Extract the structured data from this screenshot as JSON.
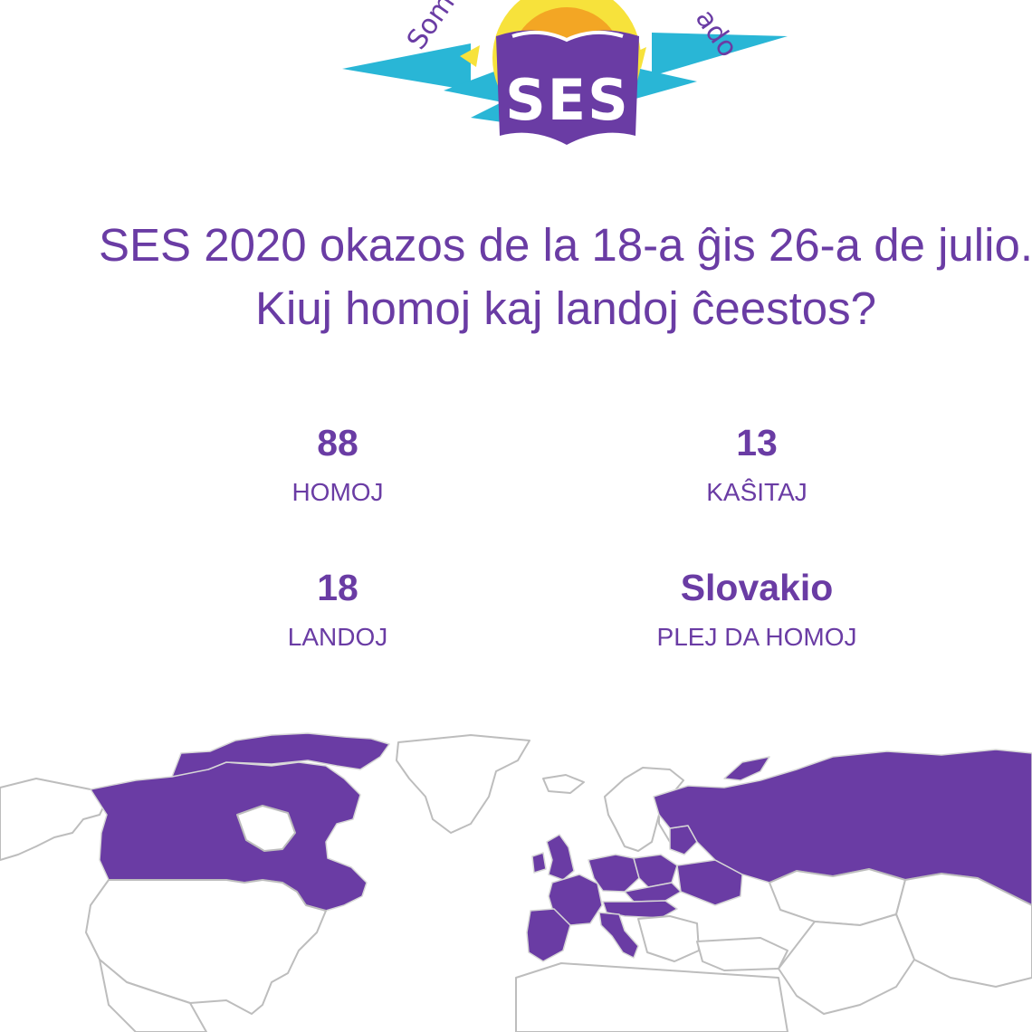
{
  "logo": {
    "abbreviation": "SES",
    "arc_left": "Som",
    "arc_right": "ado",
    "colors": {
      "purple": "#6a3ca4",
      "cyan": "#29b6d6",
      "yellow": "#f7e23b",
      "orange": "#f3a624"
    }
  },
  "headline": {
    "line1": "SES 2020 okazos de la 18-a ĝis 26-a de julio.",
    "line2": "Kiuj homoj kaj landoj ĉeestos?"
  },
  "stats": [
    {
      "value": "88",
      "label": "HOMOJ"
    },
    {
      "value": "13",
      "label": "KAŜITAJ"
    },
    {
      "value": "18",
      "label": "LANDOJ"
    },
    {
      "value": "Slovakio",
      "label": "PLEJ DA HOMOJ"
    }
  ],
  "map": {
    "highlight_color": "#6a3ca4",
    "base_color": "#ffffff",
    "border_color": "#bdbdbd"
  }
}
